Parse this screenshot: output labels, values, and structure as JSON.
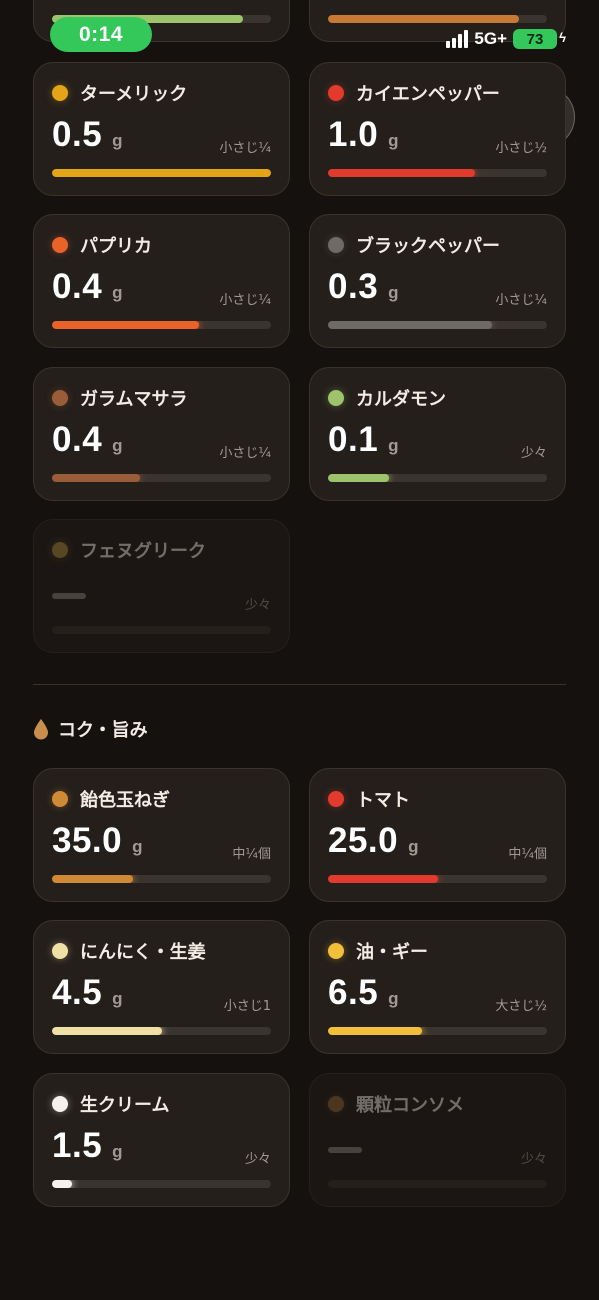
{
  "status_bar": {
    "timer": "0:14",
    "network": "5G+",
    "battery": "73"
  },
  "spice_cards": [
    {
      "name": "ターメリック",
      "value": "0.5",
      "unit": "g",
      "measure": "小さじ¼",
      "color": "#e3a417",
      "fill": 1.0
    },
    {
      "name": "カイエンペッパー",
      "value": "1.0",
      "unit": "g",
      "measure": "小さじ½",
      "color": "#e23a2c",
      "fill": 0.67
    },
    {
      "name": "パプリカ",
      "value": "0.4",
      "unit": "g",
      "measure": "小さじ¼",
      "color": "#e8622a",
      "fill": 0.67
    },
    {
      "name": "ブラックペッパー",
      "value": "0.3",
      "unit": "g",
      "measure": "小さじ¼",
      "color": "#6e6a66",
      "fill": 0.75
    },
    {
      "name": "ガラムマサラ",
      "value": "0.4",
      "unit": "g",
      "measure": "小さじ¼",
      "color": "#9a5d3a",
      "fill": 0.4
    },
    {
      "name": "カルダモン",
      "value": "0.1",
      "unit": "g",
      "measure": "少々",
      "color": "#9dc46a",
      "fill": 0.28
    },
    {
      "name": "フェヌグリーク",
      "value": "",
      "unit": "",
      "measure": "少々",
      "color": "#b39342",
      "fill": 0
    }
  ],
  "section": {
    "title": "コク・旨み"
  },
  "umami_cards": [
    {
      "name": "飴色玉ねぎ",
      "value": "35.0",
      "unit": "g",
      "measure": "中¼個",
      "color": "#d08a35",
      "fill": 0.37
    },
    {
      "name": "トマト",
      "value": "25.0",
      "unit": "g",
      "measure": "中¼個",
      "color": "#e23a2c",
      "fill": 0.5
    },
    {
      "name": "にんにく・生姜",
      "value": "4.5",
      "unit": "g",
      "measure": "小さじ1",
      "color": "#efe0a6",
      "fill": 0.5
    },
    {
      "name": "油・ギー",
      "value": "6.5",
      "unit": "g",
      "measure": "大さじ½",
      "color": "#f2bf3b",
      "fill": 0.43
    },
    {
      "name": "生クリーム",
      "value": "1.5",
      "unit": "g",
      "measure": "少々",
      "color": "#f6f1ea",
      "fill": 0.09
    },
    {
      "name": "顆粒コンソメ",
      "value": "",
      "unit": "",
      "measure": "少々",
      "color": "#9c6a3a",
      "fill": 0
    }
  ],
  "top_partial_bars": [
    {
      "color": "#9dc46a",
      "fill": 0.87
    },
    {
      "color": "#c87a35",
      "fill": 0.87
    }
  ]
}
